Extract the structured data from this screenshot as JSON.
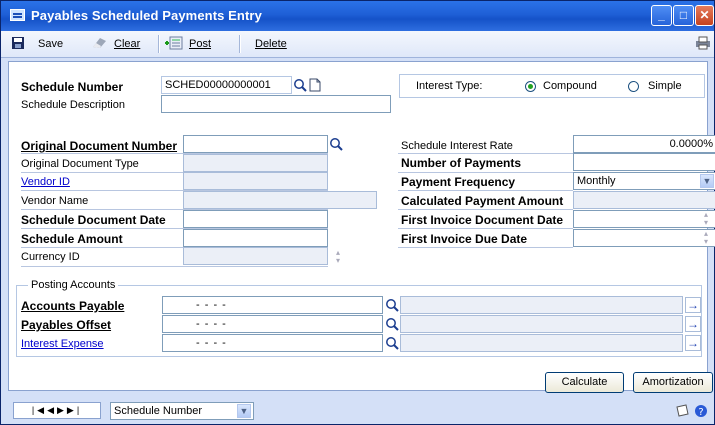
{
  "window": {
    "title": "Payables Scheduled Payments Entry"
  },
  "toolbar": {
    "save": "Save",
    "clear": "Clear",
    "post": "Post",
    "delete": "Delete"
  },
  "header": {
    "schedule_number_label": "Schedule Number",
    "schedule_number_value": "SCHED00000000001",
    "schedule_description_label": "Schedule Description",
    "schedule_description_value": "",
    "interest_type_label": "Interest Type:",
    "interest_options": [
      "Compound",
      "Simple"
    ],
    "interest_selected": "Compound"
  },
  "left": {
    "original_document_number": "Original Document Number",
    "original_document_type": "Original Document Type",
    "vendor_id": "Vendor ID",
    "vendor_name": "Vendor Name",
    "schedule_document_date": "Schedule Document Date",
    "schedule_amount": "Schedule Amount",
    "currency_id": "Currency ID"
  },
  "right": {
    "schedule_interest_rate": "Schedule Interest Rate",
    "schedule_interest_rate_value": "0.0000%",
    "number_of_payments": "Number of Payments",
    "payment_frequency": "Payment Frequency",
    "payment_frequency_value": "Monthly",
    "calculated_payment_amount": "Calculated Payment Amount",
    "first_invoice_document_date": "First Invoice Document Date",
    "first_invoice_due_date": "First Invoice Due Date"
  },
  "posting": {
    "group_label": "Posting Accounts",
    "rows": [
      {
        "label": "Accounts Payable",
        "account": "-   -   -   -",
        "style": "bold"
      },
      {
        "label": "Payables Offset",
        "account": "-   -   -   -",
        "style": "bold"
      },
      {
        "label": "Interest Expense",
        "account": "-   -   -   -",
        "style": "link"
      }
    ]
  },
  "buttons": {
    "calculate": "Calculate",
    "amortization": "Amortization"
  },
  "statusbar": {
    "sort_by": "Schedule Number"
  },
  "colors": {
    "title_bar": "#1e5fd6",
    "window_bg": "#d4e0f7",
    "link": "#0000cc"
  }
}
